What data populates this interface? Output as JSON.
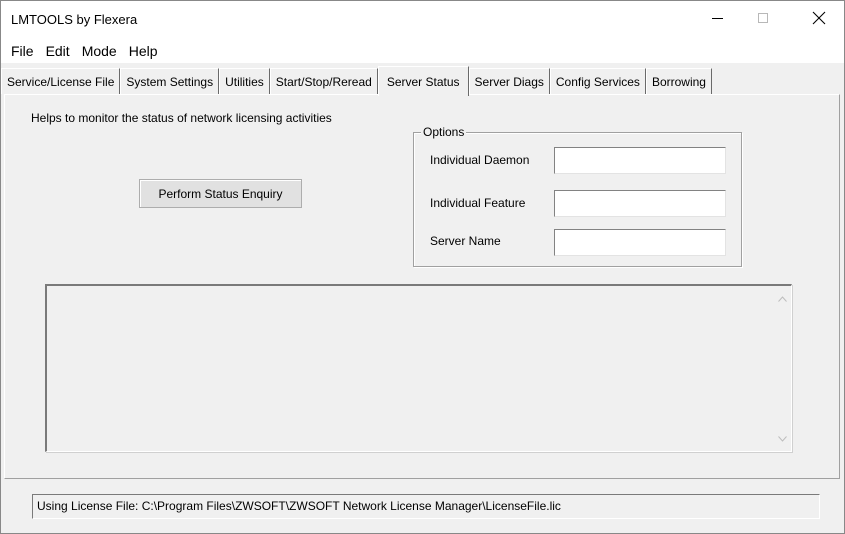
{
  "window": {
    "title": "LMTOOLS by Flexera",
    "controls": {
      "minimize": "minimize-icon",
      "maximize": "maximize-icon",
      "close": "close-icon"
    }
  },
  "menu": [
    "File",
    "Edit",
    "Mode",
    "Help"
  ],
  "tabs": [
    "Service/License File",
    "System Settings",
    "Utilities",
    "Start/Stop/Reread",
    "Server Status",
    "Server Diags",
    "Config Services",
    "Borrowing"
  ],
  "active_tab": "Server Status",
  "panel": {
    "help_text": "Helps to monitor the status of network licensing activities",
    "enquiry_button": "Perform Status Enquiry",
    "options": {
      "title": "Options",
      "daemon_label": "Individual Daemon",
      "daemon_value": "",
      "feature_label": "Individual Feature",
      "feature_value": "",
      "server_label": "Server Name",
      "server_value": ""
    },
    "output_text": ""
  },
  "status_bar": "Using License File:  C:\\Program Files\\ZWSOFT\\ZWSOFT Network License Manager\\LicenseFile.lic"
}
